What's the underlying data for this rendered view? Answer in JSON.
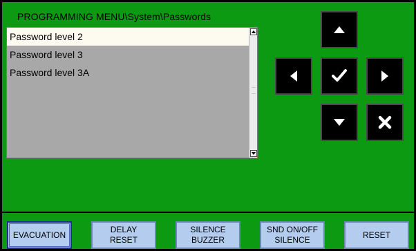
{
  "menu": {
    "title": "PROGRAMMING MENU\\System\\Passwords"
  },
  "list": {
    "items": [
      {
        "label": "Password level 2",
        "selected": true
      },
      {
        "label": "Password level 3",
        "selected": false
      },
      {
        "label": "Password level 3A",
        "selected": false
      }
    ]
  },
  "navigation": {
    "up_icon": "arrow-up-icon",
    "left_icon": "arrow-left-icon",
    "ok_icon": "checkmark-icon",
    "right_icon": "arrow-right-icon",
    "down_icon": "arrow-down-icon",
    "cancel_icon": "cross-icon"
  },
  "function_keys": [
    {
      "label": "EVACUATION",
      "active": true
    },
    {
      "label": "DELAY\nRESET",
      "active": false
    },
    {
      "label": "SILENCE\nBUZZER",
      "active": false
    },
    {
      "label": "SND ON/OFF\nSILENCE",
      "active": false
    },
    {
      "label": "RESET",
      "active": false
    }
  ],
  "colors": {
    "background": "#0b9a12",
    "list_background": "#a8a8a8",
    "selected_row": "#fdfaf0",
    "nav_button": "#000000",
    "function_key": "#b4cdef"
  }
}
